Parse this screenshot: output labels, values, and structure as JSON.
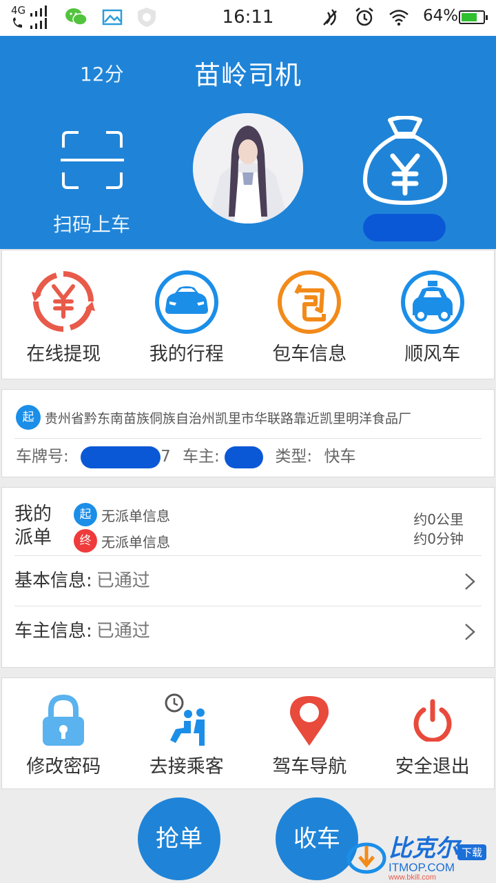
{
  "status_bar": {
    "network_label": "4G",
    "time": "16:11",
    "battery_percent": "64%",
    "battery_level": 0.64,
    "icons": [
      "signal-icon",
      "call-signal-icon",
      "wechat-icon",
      "gallery-icon",
      "shield-icon",
      "nfc-icon",
      "alarm-icon",
      "wifi-icon",
      "battery-icon"
    ]
  },
  "header": {
    "score": "12分",
    "title": "苗岭司机",
    "scan_label": "扫码上车",
    "balance_hidden": true
  },
  "quick_actions": [
    {
      "label": "在线提现",
      "icon": "yen-refresh-icon",
      "color": "#e85a4a"
    },
    {
      "label": "我的行程",
      "icon": "car-front-icon",
      "color": "#1b8ee8"
    },
    {
      "label": "包车信息",
      "icon": "bao-charter-icon",
      "color": "#f28a1a"
    },
    {
      "label": "顺风车",
      "icon": "taxi-car-icon",
      "color": "#1b8ee8"
    }
  ],
  "location": {
    "start_badge": "起",
    "address": "贵州省黔东南苗族侗族自治州凯里市华联路靠近凯里明洋食品厂",
    "plate_label": "车牌号:",
    "plate_tail": "7",
    "owner_label": "车主:",
    "type_label": "类型:",
    "type_value": "快车"
  },
  "dispatch": {
    "title": "我的派单",
    "start_badge": "起",
    "end_badge": "终",
    "start_text": "无派单信息",
    "end_text": "无派单信息",
    "distance": "约0公里",
    "duration": "约0分钟"
  },
  "info_rows": [
    {
      "key": "基本信息:",
      "value": "已通过"
    },
    {
      "key": "车主信息:",
      "value": "已通过"
    }
  ],
  "tools": [
    {
      "label": "修改密码",
      "icon": "lock-icon",
      "color": "#5ab2ee"
    },
    {
      "label": "去接乘客",
      "icon": "pickup-passenger-icon",
      "color": "#1b8ee8"
    },
    {
      "label": "驾车导航",
      "icon": "map-pin-icon",
      "color": "#e84a3c"
    },
    {
      "label": "安全退出",
      "icon": "power-icon",
      "color": "#e84a3c"
    }
  ],
  "actions": {
    "grab_order": "抢单",
    "finish_work": "收车"
  },
  "watermark": {
    "brand": "比克尔",
    "badge": "下载",
    "site": "ITMOP.COM",
    "site2": "www.bkill.com"
  }
}
